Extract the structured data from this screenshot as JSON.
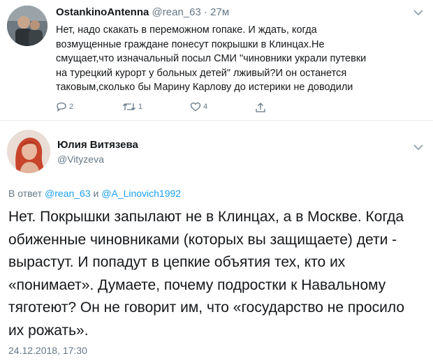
{
  "tweet1": {
    "author_name": "OstankinoAntenna",
    "handle": "@rean_63",
    "separator": "·",
    "time": "27м",
    "lines": [
      "Нет, надо скакать в переможном гопаке. И ждать, когда",
      "возмущенные граждане понесут покрышки в Клинцах.Не",
      "смущает,что изначальный посыл СМИ \"чиновники украли путевки",
      "на турецкий курорт у больных детей\" лживый?И он останется",
      "таковым,сколько бы Марину Карлову до истерики не доводили"
    ],
    "replies_count": "2",
    "retweets_count": "1",
    "likes_count": "4",
    "icons": {
      "reply": "reply-icon",
      "retweet": "retweet-icon",
      "like": "heart-icon",
      "share": "share-icon",
      "menu": "chevron-down-icon"
    }
  },
  "tweet2": {
    "author_name": "Юлия Витязева",
    "handle": "@Vityzeva",
    "reply_prefix": "В ответ",
    "reply_handle_1": "@rean_63",
    "reply_conj": "и",
    "reply_handle_2": "@A_Linovich1992",
    "lines": [
      "Нет. Покрышки запылают не в Клинцах, а в Москве. Когда",
      "обиженные чиновниками (которых вы защищаете) дети -",
      "вырастут. И попадут в цепкие объятия тех, кто их",
      "«понимает». Думаете, почему подростки к Навальному",
      "тяготеют? Он не говорит им, что «государство не просило",
      "их рожать»."
    ],
    "timestamp": "24.12.2018, 17:30"
  },
  "colors": {
    "text": "#14171a",
    "secondary": "#657786",
    "link": "#1da1f2",
    "divider": "#e6ecf0"
  }
}
